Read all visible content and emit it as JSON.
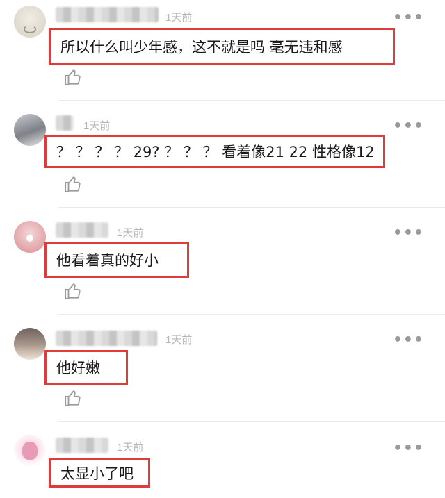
{
  "comments": [
    {
      "time": "1天前",
      "text": "所以什么叫少年感，这不就是吗  毫无违和感",
      "more": "•••",
      "avatar_color": "#e8e4da"
    },
    {
      "time": "1天前",
      "text": "？ ？ ？ ？ 29? ？ ？ ？  看着像21 22 性格像12",
      "more": "•••",
      "avatar_color": "#9a9ca3"
    },
    {
      "time": "1天前",
      "text": "他看着真的好小",
      "more": "•••",
      "avatar_color": "#d9959a"
    },
    {
      "time": "1天前",
      "text": "他好嫩",
      "more": "•••",
      "avatar_color": "#8a7a70"
    },
    {
      "time": "1天前",
      "text": "太显小了吧",
      "more": "•••",
      "avatar_color": "#e79bb6"
    }
  ],
  "colors": {
    "highlight_border": "#e03a3a",
    "timestamp": "#b5b5b5"
  },
  "icons": {
    "like": "thumbs-up-icon",
    "more": "more-dots-icon"
  }
}
